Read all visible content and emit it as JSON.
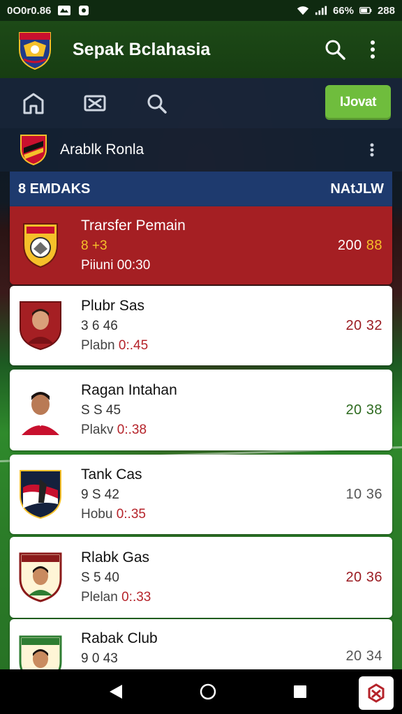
{
  "status_bar": {
    "clock": "0O0r0.86",
    "battery_percent": "66%",
    "time_right": "288",
    "icons": [
      "notification-icon",
      "shield-notification-icon",
      "wifi-icon",
      "signal-icon",
      "battery-icon"
    ]
  },
  "app_bar": {
    "title": "Sepak Bclahasia",
    "icons": [
      "club-logo-icon",
      "search-icon",
      "more-vert-icon"
    ]
  },
  "toolbar": {
    "icons": [
      "home-icon",
      "transfer-icon",
      "search-icon"
    ],
    "action_label": "IJovat",
    "action_color": "#6fbd3d"
  },
  "team_row": {
    "name": "Arablk Ronla",
    "icons": [
      "team-crest-icon",
      "more-vert-icon"
    ]
  },
  "list_header": {
    "left": "8 EMDAKS",
    "right": "NAtJLW",
    "color": "#1e3a6e"
  },
  "items": [
    {
      "title": "Trarsfer Pemain",
      "meta": "8 +3",
      "time_label": "Piiuni ",
      "time_value": "00:30",
      "score_main": "200",
      "score_tail": " 88",
      "score_color": "#ffffff",
      "icon": "club-crest-icon",
      "featured": true
    },
    {
      "title": "Plubr Sas",
      "meta": "3 6 46",
      "time_label": "Plabn ",
      "time_value": "0:.45",
      "score_main": "20 32",
      "score_tail": "",
      "score_color": "#9b1c22",
      "icon": "player-avatar-icon",
      "featured": false
    },
    {
      "title": "Ragan Intahan",
      "meta": "S S 45",
      "time_label": "Plakv ",
      "time_value": "0:.38",
      "score_main": "20 38",
      "score_tail": "",
      "score_color": "#2d6a1f",
      "icon": "player-avatar-icon",
      "featured": false
    },
    {
      "title": "Tank Cas",
      "meta": "9 S 42",
      "time_label": "Hobu ",
      "time_value": "0:.35",
      "score_main": "10 36",
      "score_tail": "",
      "score_color": "#555555",
      "icon": "club-crest-icon",
      "featured": false
    },
    {
      "title": "Rlabk Gas",
      "meta": "S 5 40",
      "time_label": "Plelan ",
      "time_value": "0:.33",
      "score_main": "20 36",
      "score_tail": "",
      "score_color": "#9b1c22",
      "icon": "player-badge-icon",
      "featured": false
    },
    {
      "title": "Rabak Club",
      "meta": "9 0 43",
      "time_label": "",
      "time_value": "",
      "score_main": "20 34",
      "score_tail": "",
      "score_color": "#555555",
      "icon": "player-badge-icon",
      "featured": false
    }
  ],
  "nav_bar": {
    "icons": [
      "back-icon",
      "home-circle-icon",
      "recents-icon",
      "app-shortcut-icon"
    ]
  }
}
